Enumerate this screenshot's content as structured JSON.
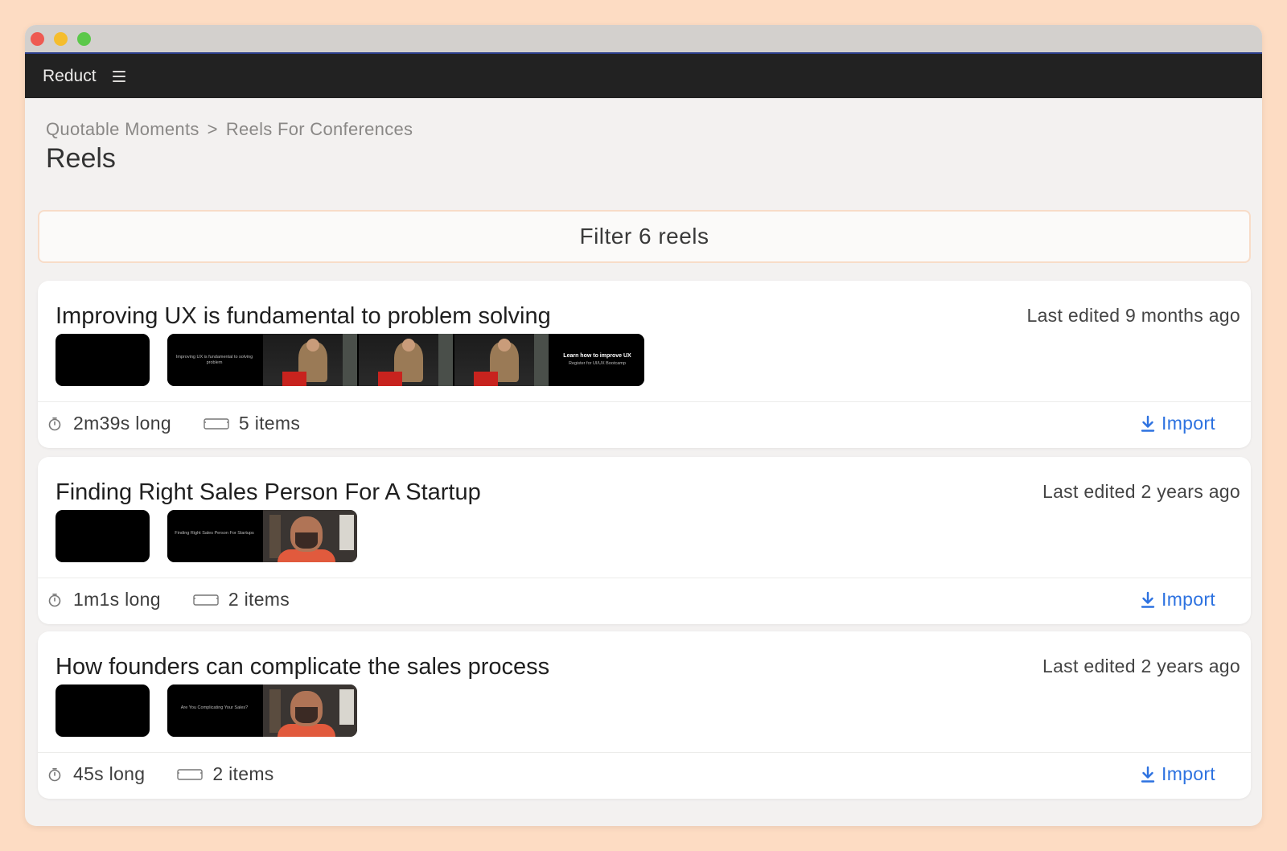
{
  "app": {
    "title": "Reduct"
  },
  "breadcrumb": {
    "parent": "Quotable Moments",
    "separator": ">",
    "current": "Reels For Conferences"
  },
  "page": {
    "title": "Reels"
  },
  "filter": {
    "placeholder": "Filter 6 reels"
  },
  "reels": [
    {
      "title": "Improving UX is fundamental to problem solving",
      "edited": "Last edited 9 months ago",
      "duration": "2m39s long",
      "items": "5 items",
      "import_label": "Import",
      "frames": [
        {
          "kind": "text",
          "text": "Improving UX is fundamental to solving problem"
        },
        {
          "kind": "stage"
        },
        {
          "kind": "stage"
        },
        {
          "kind": "stage"
        },
        {
          "kind": "text-bold",
          "text": "Learn how to improve UX",
          "subtext": "Register for UI/UX Bootcamp"
        }
      ]
    },
    {
      "title": "Finding Right Sales Person For A Startup",
      "edited": "Last edited 2 years ago",
      "duration": "1m1s long",
      "items": "2 items",
      "import_label": "Import",
      "frames": [
        {
          "kind": "text",
          "text": "Finding Right Sales Person For Startups"
        },
        {
          "kind": "cam"
        }
      ]
    },
    {
      "title": "How founders can complicate the sales process",
      "edited": "Last edited 2 years ago",
      "duration": "45s long",
      "items": "2 items",
      "import_label": "Import",
      "frames": [
        {
          "kind": "text",
          "text": "Are You Complicating Your Sales?"
        },
        {
          "kind": "cam"
        }
      ]
    }
  ],
  "colors": {
    "accent": "#2d72e0",
    "appbar": "#222222",
    "page_bg": "#fddcc3"
  },
  "icons": {
    "menu": "hamburger-icon",
    "timer": "timer-icon",
    "items": "items-icon",
    "import": "download-icon"
  }
}
